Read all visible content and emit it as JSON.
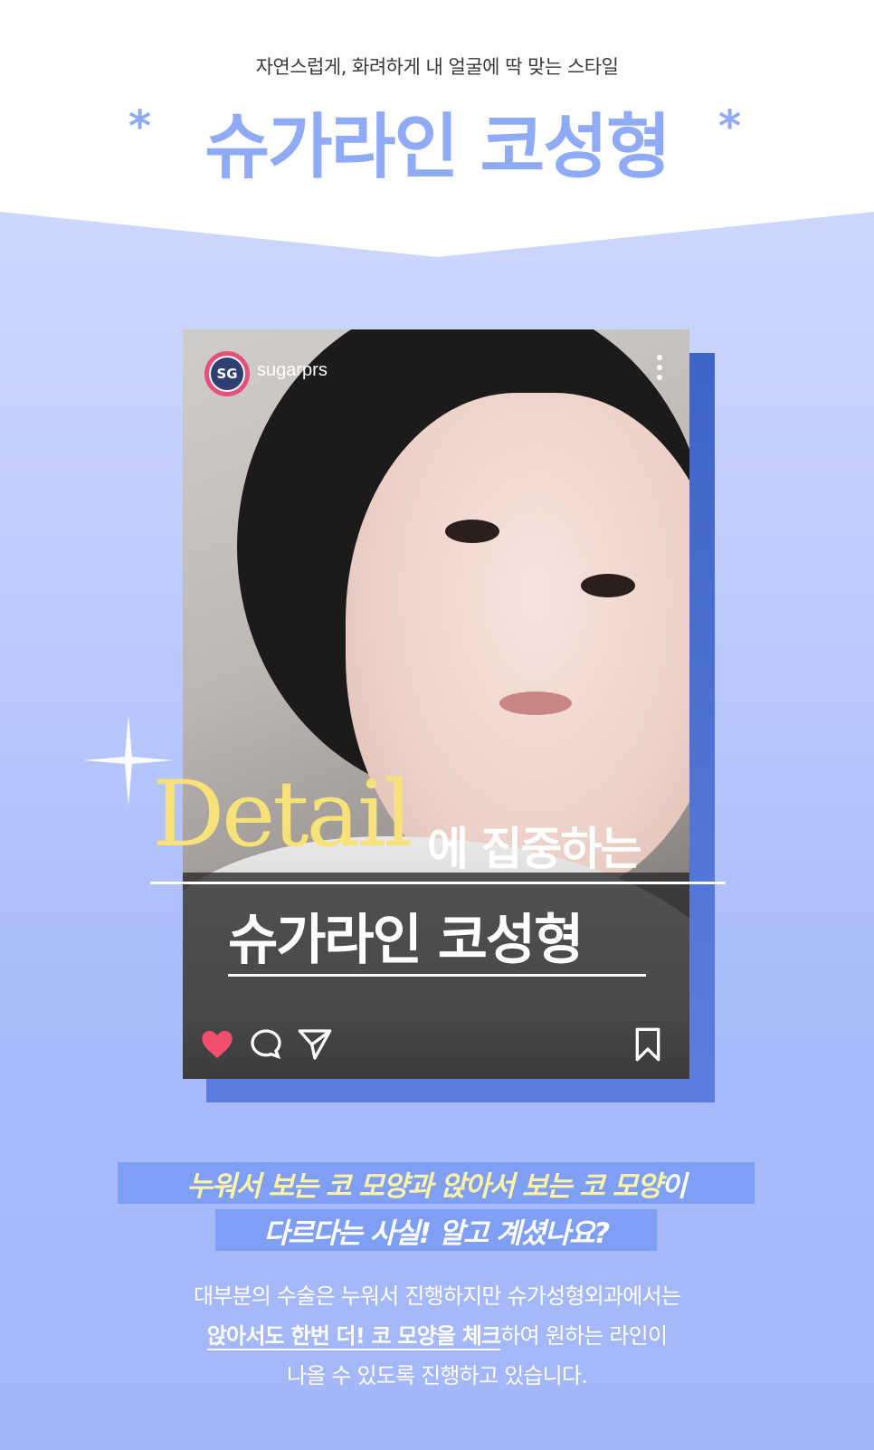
{
  "header": {
    "subtitle": "자연스럽게, 화려하게 내 얼굴에 딱 맞는 스타일",
    "title": "슈가라인 코성형",
    "asterisk": "*"
  },
  "post": {
    "avatar_text": "SG",
    "username": "sugarprs",
    "detail_word": "Detail",
    "focus_text": "에 집중하는",
    "name": "슈가라인 코성형"
  },
  "info": {
    "highlight_line1_a": "누워서 보는 코 모양과  앉아서 보는 코 모양",
    "highlight_line1_b": "이",
    "highlight_line2": "다르다는 사실! 알고 계셨나요?",
    "body_line1": "대부분의 수술은 누워서 진행하지만 슈가성형외과에서는",
    "body_line2_emph": "앉아서도 한번 더! 코 모양을 체크",
    "body_line2_rest": "하여 원하는 라인이",
    "body_line3": "나올 수 있도록 진행하고 있습니다."
  },
  "colors": {
    "accent": "#8faaf7",
    "highlight_bg": "#7f9ff4",
    "detail_yellow": "#f7e27a",
    "heart": "#f0506e"
  }
}
